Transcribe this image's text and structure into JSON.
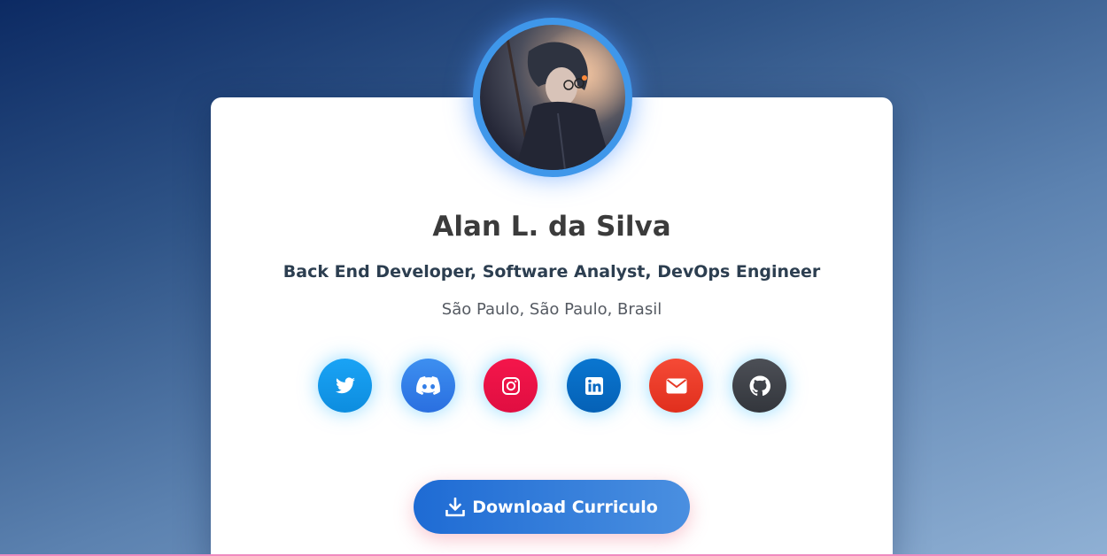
{
  "profile": {
    "name": "Alan L. da Silva",
    "role": "Back End Developer, Software Analyst, DevOps Engineer",
    "location": "São Paulo, São Paulo, Brasil",
    "avatar": "profile-avatar"
  },
  "socials": [
    {
      "network": "twitter",
      "icon": "twitter-icon",
      "color": "#1aa3f5"
    },
    {
      "network": "discord",
      "icon": "discord-icon",
      "color": "#3d8ff0"
    },
    {
      "network": "instagram",
      "icon": "instagram-icon",
      "color": "#f4164b"
    },
    {
      "network": "linkedin",
      "icon": "linkedin-icon",
      "color": "#0a76d0"
    },
    {
      "network": "email",
      "icon": "envelope-icon",
      "color": "#f54a36"
    },
    {
      "network": "github",
      "icon": "github-icon",
      "color": "#4c4f56"
    }
  ],
  "download": {
    "label": "Download Curriculo",
    "icon": "download-icon"
  },
  "colors": {
    "accent": "#3f97ea",
    "button_start": "#1e6bd4",
    "button_end": "#4a8fe0",
    "name_text": "#3b3b3b",
    "role_text": "#2c3e50"
  }
}
